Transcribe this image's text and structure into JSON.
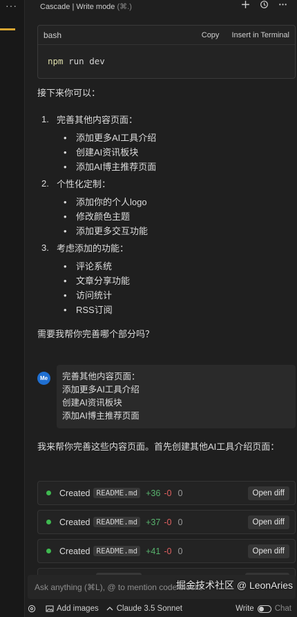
{
  "left_strip": {
    "menu": "···"
  },
  "header": {
    "title": "Cascade | Write mode",
    "shortcut": "(⌘.)",
    "icons": [
      "plus-icon",
      "history-icon",
      "more-icon"
    ]
  },
  "codeblock": {
    "language": "bash",
    "copy_label": "Copy",
    "insert_label": "Insert in Terminal",
    "command_keyword": "npm",
    "command_rest": " run dev"
  },
  "assistant_intro": "接下来你可以：",
  "steps": [
    {
      "number": "1.",
      "title": "完善其他内容页面：",
      "bullets": [
        "添加更多AI工具介绍",
        "创建AI资讯板块",
        "添加AI博主推荐页面"
      ]
    },
    {
      "number": "2.",
      "title": "个性化定制：",
      "bullets": [
        "添加你的个人logo",
        "修改颜色主题",
        "添加更多交互功能"
      ]
    },
    {
      "number": "3.",
      "title": "考虑添加的功能：",
      "bullets": [
        "评论系统",
        "文章分享功能",
        "访问统计",
        "RSS订阅"
      ]
    }
  ],
  "assistant_question": "需要我帮你完善哪个部分吗？",
  "user_message": {
    "avatar": "Me",
    "lines": [
      "完善其他内容页面：",
      "添加更多AI工具介绍",
      "创建AI资讯板块",
      "添加AI博主推荐页面"
    ]
  },
  "assistant_reply": "我来帮你完善这些内容页面。首先创建其他AI工具介绍页面：",
  "file_changes": [
    {
      "status": "Created",
      "file": "README.md",
      "added": "+36",
      "removed": "-0",
      "other": "0",
      "action": "Open diff"
    },
    {
      "status": "Created",
      "file": "README.md",
      "added": "+37",
      "removed": "-0",
      "other": "0",
      "action": "Open diff"
    },
    {
      "status": "Created",
      "file": "README.md",
      "added": "+41",
      "removed": "-0",
      "other": "0",
      "action": "Open diff"
    }
  ],
  "input": {
    "placeholder": "Ask anything (⌘L), @ to mention code blocks"
  },
  "watermark": "掘金技术社区 @ LeonAries",
  "bottom_bar": {
    "add_images": "Add images",
    "model": "Claude 3.5 Sonnet",
    "write_label": "Write",
    "chat_label": "Chat"
  },
  "colors": {
    "accent": "#d6a431",
    "added": "#58b36d",
    "removed": "#e06060",
    "avatar": "#1f6fd1"
  }
}
